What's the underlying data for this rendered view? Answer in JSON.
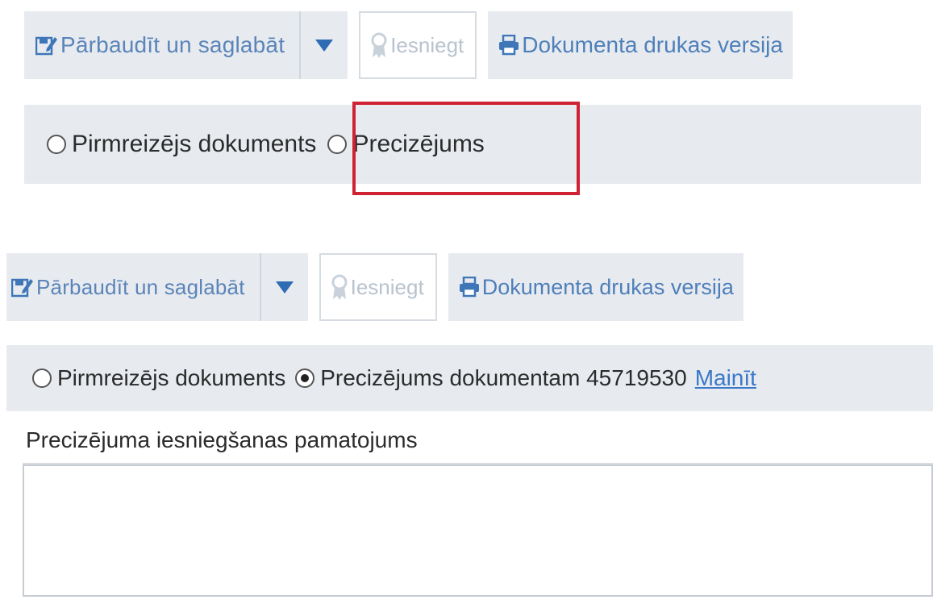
{
  "toolbar_top": {
    "save_label": "Pārbaudīt un saglabāt",
    "submit_label": "Iesniegt",
    "print_label": "Dokumenta drukas versija"
  },
  "radio_top": {
    "option1_label": "Pirmreizējs dokuments",
    "option2_label": "Precizējums",
    "selected": "none"
  },
  "toolbar_bottom": {
    "save_label": "Pārbaudīt un saglabāt",
    "submit_label": "Iesniegt",
    "print_label": "Dokumenta drukas versija"
  },
  "radio_bottom": {
    "option1_label": "Pirmreizējs dokuments",
    "option2_label": "Precizējums dokumentam 45719530",
    "change_link": "Mainīt",
    "selected": "option2"
  },
  "justification": {
    "label": "Precizējuma iesniegšanas pamatojums",
    "value": ""
  },
  "colors": {
    "toolbar_bg": "#e7ebf0",
    "link_blue": "#4f7fb9",
    "dropdown_blue": "#2f6cb3",
    "highlight_red": "#cf2233",
    "disabled_gray": "#b9c3cf"
  },
  "icons": {
    "save": "save-edit-icon",
    "dropdown": "chevron-down-icon",
    "submit": "award-icon",
    "print": "printer-icon"
  }
}
